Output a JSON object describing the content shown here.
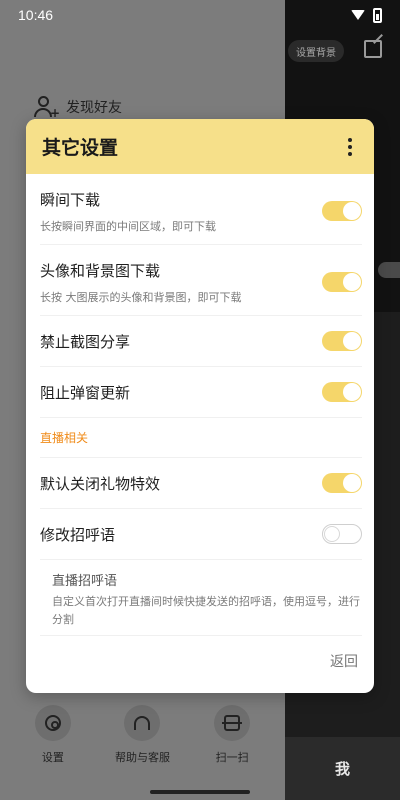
{
  "status_bar": {
    "time": "10:46"
  },
  "background": {
    "friend_label": "发现好友",
    "chip_label": "设置背景",
    "me_label": "我",
    "tools": [
      {
        "label": "设置",
        "icon": "settings-icon"
      },
      {
        "label": "帮助与客服",
        "icon": "headset-icon"
      },
      {
        "label": "扫一扫",
        "icon": "scan-icon"
      }
    ]
  },
  "dialog": {
    "title": "其它设置",
    "items": [
      {
        "title": "瞬间下载",
        "subtitle": "长按瞬间界面的中间区域，即可下载",
        "enabled": true
      },
      {
        "title": "头像和背景图下载",
        "subtitle": "长按 大图展示的头像和背景图，即可下载",
        "enabled": true
      },
      {
        "title": "禁止截图分享",
        "enabled": true
      },
      {
        "title": "阻止弹窗更新",
        "enabled": true
      }
    ],
    "section_live": "直播相关",
    "live_items": [
      {
        "title": "默认关闭礼物特效",
        "enabled": true
      },
      {
        "title": "修改招呼语",
        "enabled": false
      }
    ],
    "greeting": {
      "title": "直播招呼语",
      "description": "自定义首次打开直播间时候快捷发送的招呼语，使用逗号，进行分割"
    },
    "back_label": "返回"
  },
  "colors": {
    "accent": "#f5d66a",
    "header": "#f6e08a",
    "section": "#f08c1b"
  }
}
